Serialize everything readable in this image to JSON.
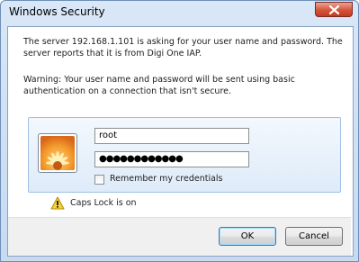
{
  "window": {
    "title": "Windows Security"
  },
  "message": {
    "line1": "The server 192.168.1.101 is asking for your user name and password. The server reports that it is from Digi One IAP.",
    "warning": "Warning: Your user name and password will be sent using basic authentication on a connection that isn't secure."
  },
  "credentials": {
    "username_value": "root",
    "password_value": "●●●●●●●●●●●●",
    "remember_label": "Remember my credentials",
    "remember_checked": false,
    "tile_icon": "flower-user-tile-icon"
  },
  "notice": {
    "caps_lock": "Caps Lock is on",
    "icon": "warning-icon"
  },
  "buttons": {
    "ok": "OK",
    "cancel": "Cancel"
  },
  "colors": {
    "title_bar": "#c7daf0",
    "close_button": "#d5543b",
    "credential_panel": "#deebf9",
    "ok_button_border": "#3c7fb1"
  }
}
